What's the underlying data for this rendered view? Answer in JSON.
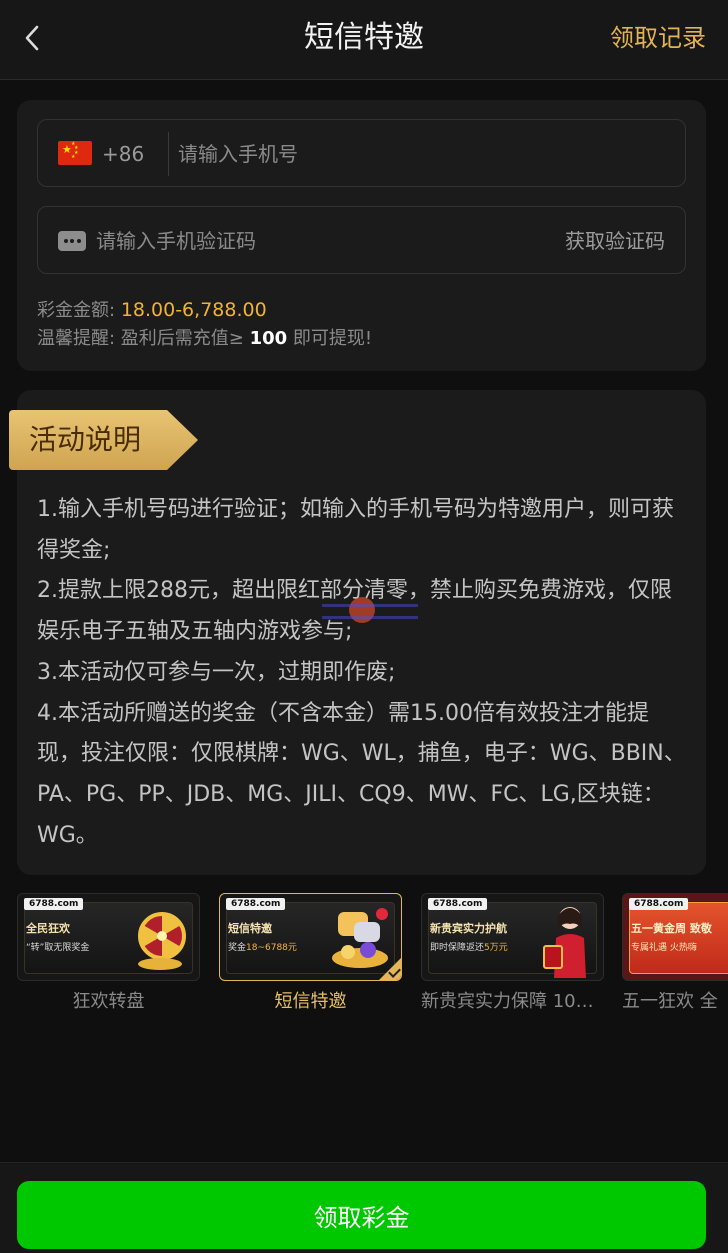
{
  "header": {
    "title": "短信特邀",
    "records_link": "领取记录"
  },
  "form": {
    "country_code": "+86",
    "phone_placeholder": "请输入手机号",
    "code_placeholder": "请输入手机验证码",
    "get_code_label": "获取验证码",
    "bonus_label": "彩金金额:",
    "bonus_amount": "18.00-6,788.00",
    "tip_prefix": "温馨提醒: 盈利后需充值≥",
    "tip_amount": "100",
    "tip_suffix": "即可提现!"
  },
  "description": {
    "title": "活动说明",
    "items": [
      "1.输入手机号码进行验证；如输入的手机号码为特邀用户，则可获得奖金;",
      "2.提款上限288元，超出限红部分清零，禁止购买免费游戏，仅限娱乐电子五轴及五轴内游戏参与;",
      "3.本活动仅可参与一次，过期即作废;",
      "4.本活动所赠送的奖金（不含本金）需15.00倍有效投注才能提现，投注仅限：仅限棋牌：WG、WL，捕鱼，电子：WG、BBIN、PA、PG、PP、JDB、MG、JILI、CQ9、MW、FC、LG,区块链：WG。"
    ]
  },
  "banners": [
    {
      "site": "6788.com",
      "title": "全民狂欢",
      "sub": "“转”取无限奖金",
      "sub_hl": "",
      "caption": "狂欢转盘",
      "active": false
    },
    {
      "site": "6788.com",
      "title": "短信特邀",
      "sub": "奖金",
      "sub_hl": "18~6788元",
      "caption": "短信特邀",
      "active": true
    },
    {
      "site": "6788.com",
      "title": "新贵宾实力护航",
      "sub": "即时保障返还",
      "sub_hl": "5万元",
      "caption": "新贵宾实力保障 10%...",
      "active": false
    },
    {
      "site": "6788.com",
      "title": "五一黄金周 致敬",
      "sub": "专属礼遇 火热嗨",
      "sub_hl": "",
      "caption": "五一狂欢 全",
      "active": false
    }
  ],
  "footer": {
    "claim_label": "领取彩金"
  },
  "colors": {
    "accent_gold": "#e4b454",
    "bonus_orange": "#f2b233",
    "claim_green": "#00c800"
  }
}
